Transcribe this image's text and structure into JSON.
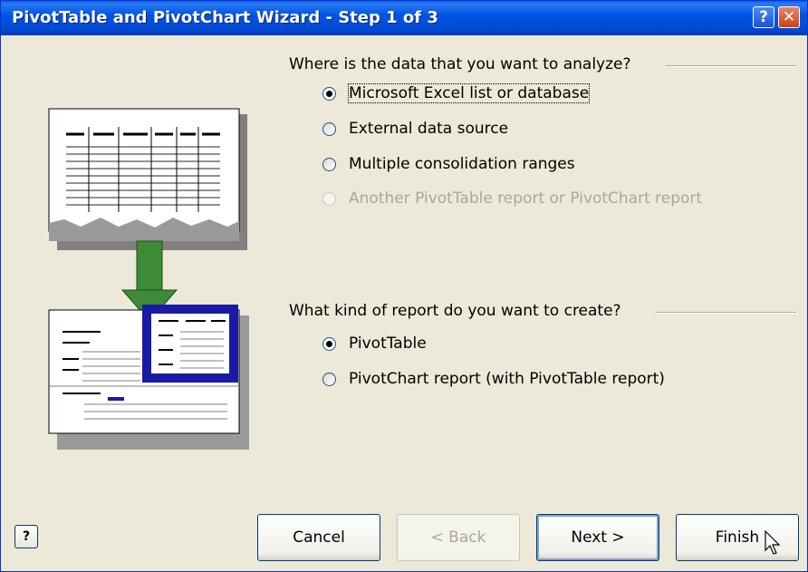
{
  "window": {
    "title": "PivotTable and PivotChart Wizard - Step 1 of 3",
    "help_glyph": "?",
    "close_glyph": "✕"
  },
  "data_source": {
    "question": "Where is the data that you want to analyze?",
    "options": [
      {
        "label": "Microsoft Excel list or database",
        "selected": true,
        "enabled": true
      },
      {
        "label": "External data source",
        "selected": false,
        "enabled": true
      },
      {
        "label": "Multiple consolidation ranges",
        "selected": false,
        "enabled": true
      },
      {
        "label": "Another PivotTable report or PivotChart report",
        "selected": false,
        "enabled": false
      }
    ]
  },
  "report_kind": {
    "question": "What kind of report do you want to create?",
    "options": [
      {
        "label": "PivotTable",
        "selected": true,
        "enabled": true
      },
      {
        "label": "PivotChart report (with PivotTable report)",
        "selected": false,
        "enabled": true
      }
    ]
  },
  "footer": {
    "help_glyph": "?",
    "cancel_label": "Cancel",
    "back_label": "< Back",
    "next_label": "Next >",
    "finish_label": "Finish"
  },
  "colors": {
    "titlebar": "#0055e5",
    "window_bg": "#ece9d8",
    "disabled_text": "#aca899",
    "arrow_green": "#3d8b37",
    "pivot_blue": "#1a1aa6"
  }
}
